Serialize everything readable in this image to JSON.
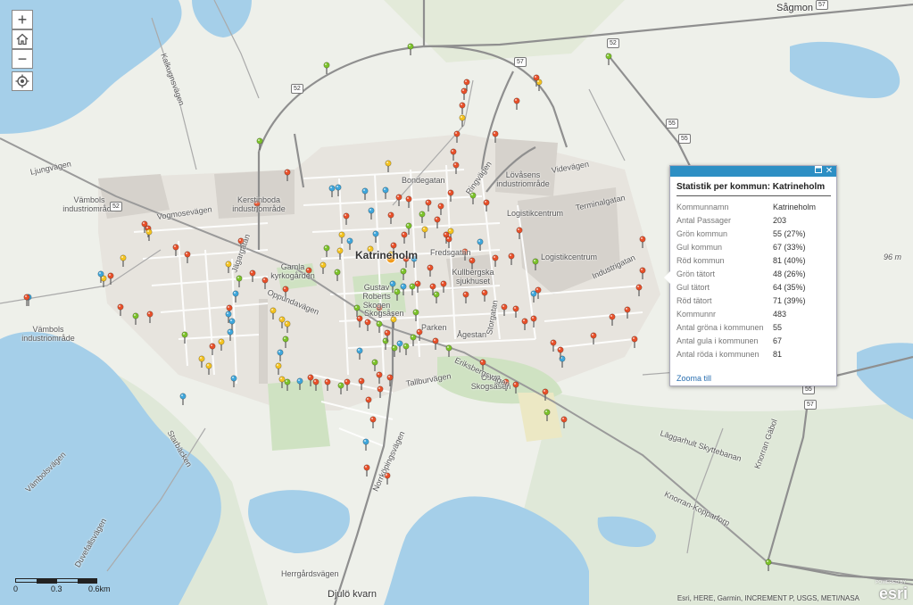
{
  "map": {
    "place_labels": {
      "city": "Katrineholm",
      "sagmon": "Sågmon",
      "djulo": "Djulö kvarn",
      "valla": "Vännbols\nindustriområde",
      "vamb1": "Vämbols\nindustriområde",
      "vamb2": "Vämbols\nindustriområde",
      "kerstin": "Kerstinboda\nindustriområde",
      "lovasen": "Lövåsens\nindustriområde",
      "logist1": "Logistikcentrum",
      "logist2": "Logistikcentrum",
      "gamla": "Gamla\nkyrkogården",
      "gustav": "Gustav\nRoberts\nSkogen",
      "kull": "Kullbergska\nsjukhuset",
      "ostra": "Östra\nSkogsåsen",
      "skogs": "Skogsåsen",
      "parken": "Parken",
      "depth": "96 m"
    },
    "street_labels": {
      "ljung": "Ljungvägen",
      "vogmos": "Vogmosevägen",
      "oppund": "Oppundavägen",
      "eriks": "Eriksbergsvägen",
      "norrk": "Norrköpingsvägen",
      "knorran": "Knorran-Kopparforp",
      "jagar": "Jägargatan",
      "terminal": "Terminalgatan",
      "industri": "Industrigatan",
      "videv": "Videvägen",
      "fredsg": "Fredsgatan",
      "bondeg": "Bondegatan",
      "ringv": "Ringvägen",
      "herrg": "Herrgårdsvägen",
      "tallb": "Tallburvägen",
      "starb": "Starbäcken",
      "vamb": "Vämbolsvägen",
      "duvet": "Duvefallsvägen",
      "lagg": "Läggarhult Skyttebanan",
      "knorr": "Knorran Gäbol",
      "kalkugn": "Kalkugnsvägen",
      "aeg": "Ågestan",
      "stor": "Storgatan"
    },
    "shields": [
      "52",
      "52",
      "57",
      "57",
      "55",
      "55",
      "55",
      "52",
      "57"
    ]
  },
  "controls": {
    "zoom_in": "+",
    "home": "home-icon",
    "zoom_out": "−",
    "locate": "locate-icon"
  },
  "popup": {
    "title": "Statistik per kommun: Katrineholm",
    "rows": [
      {
        "key": "Kommunnamn",
        "value": "Katrineholm"
      },
      {
        "key": "Antal Passager",
        "value": "203"
      },
      {
        "key": "Grön kommun",
        "value": "55 (27%)"
      },
      {
        "key": "Gul kommun",
        "value": "67 (33%)"
      },
      {
        "key": "Röd kommun",
        "value": "81 (40%)"
      },
      {
        "key": "Grön tätort",
        "value": "48 (26%)"
      },
      {
        "key": "Gul tätort",
        "value": "64 (35%)"
      },
      {
        "key": "Röd tätort",
        "value": "71 (39%)"
      },
      {
        "key": "Kommunnr",
        "value": "483"
      },
      {
        "key": "Antal gröna i kommunen",
        "value": "55"
      },
      {
        "key": "Antal gula i kommunen",
        "value": "67"
      },
      {
        "key": "Antal röda i kommunen",
        "value": "81"
      }
    ],
    "zoom_link": "Zooma till",
    "maximize_icon": "maximize-icon",
    "close_icon": "close-icon"
  },
  "scale": {
    "t0": "0",
    "t1": "0.3",
    "t2": "0.6km"
  },
  "attribution": "Esri, HERE, Garmin, INCREMENT P, USGS, METI/NASA",
  "esri_logo": "esri",
  "esri_powered": "POWERED BY",
  "colors": {
    "water": "#a5cfe9",
    "urban": "#dedbd5",
    "green": "#cfe2c2",
    "road": "#8f8f8f",
    "marker_green": "#7cc22a",
    "marker_yellow": "#f4c320",
    "marker_red": "#e8502a",
    "marker_blue": "#3fa7dc",
    "popup_header": "#2d8fc4"
  }
}
